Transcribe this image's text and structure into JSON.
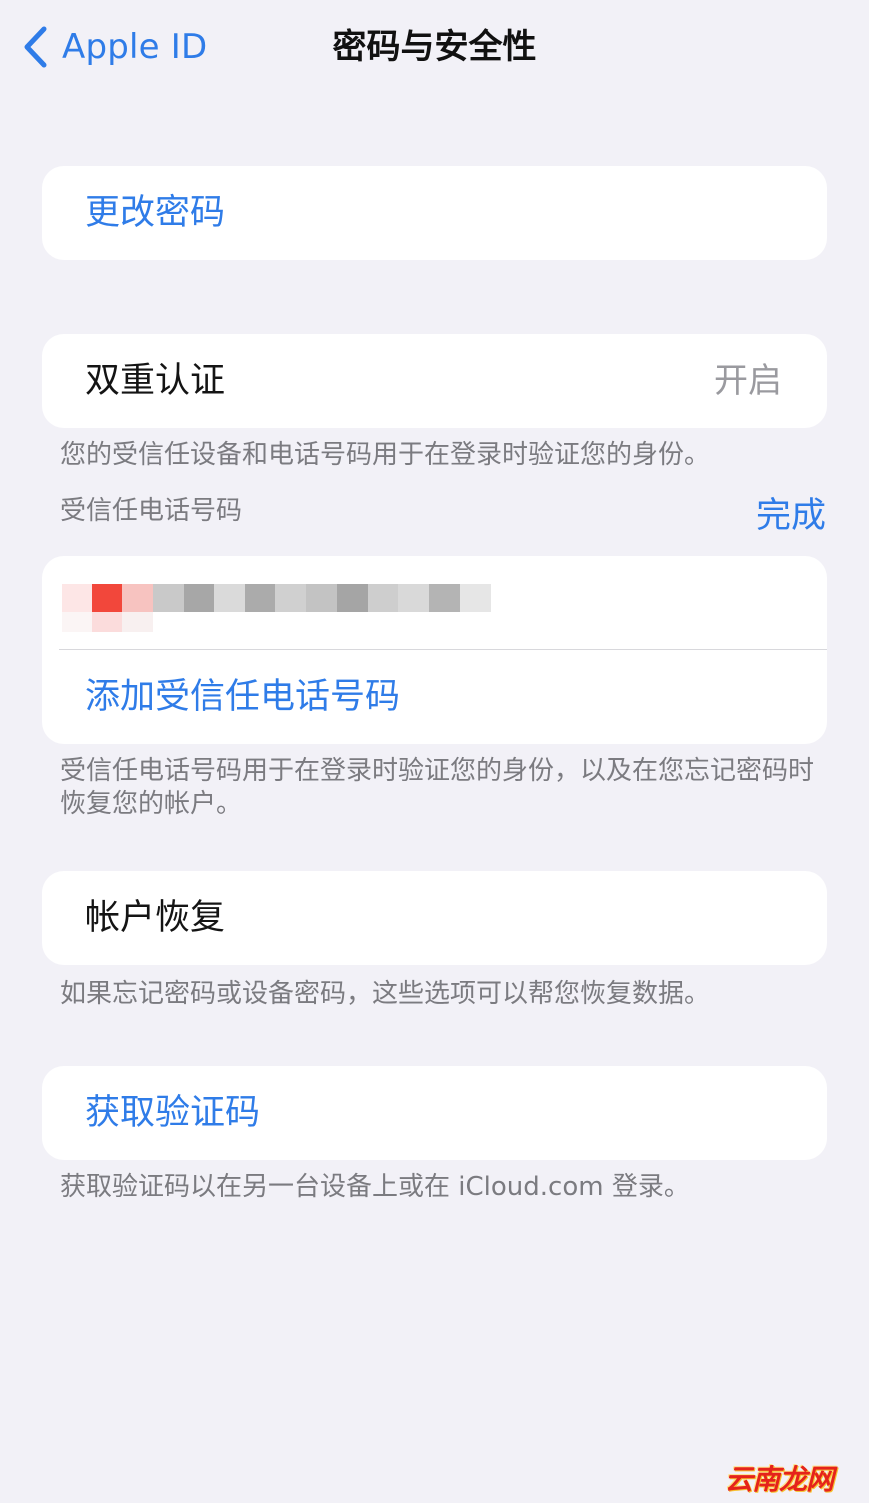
{
  "nav": {
    "back_label": "Apple ID",
    "title": "密码与安全性",
    "back_icon": "chevron-left-icon"
  },
  "change_password": {
    "label": "更改密码"
  },
  "two_factor": {
    "label": "双重认证",
    "value": "开启",
    "footnote": "您的受信任设备和电话号码用于在登录时验证您的身份。"
  },
  "trusted_phone": {
    "section_label": "受信任电话号码",
    "done_label": "完成",
    "add_label": "添加受信任电话号码",
    "footnote": "受信任电话号码用于在登录时验证您的身份，以及在您忘记密码时恢复您的帐户。"
  },
  "account_recovery": {
    "label": "帐户恢复",
    "footnote": "如果忘记密码或设备密码，这些选项可以帮您恢复数据。"
  },
  "verification_code": {
    "label": "获取验证码",
    "footnote": "获取验证码以在另一台设备上或在 iCloud.com 登录。"
  },
  "watermark": {
    "text": "云南龙网"
  },
  "colors": {
    "background": "#f2f1f7",
    "card": "#ffffff",
    "accent": "#2f7ce8",
    "secondary_text": "#7b7b80",
    "value_text": "#9a9a9f"
  }
}
